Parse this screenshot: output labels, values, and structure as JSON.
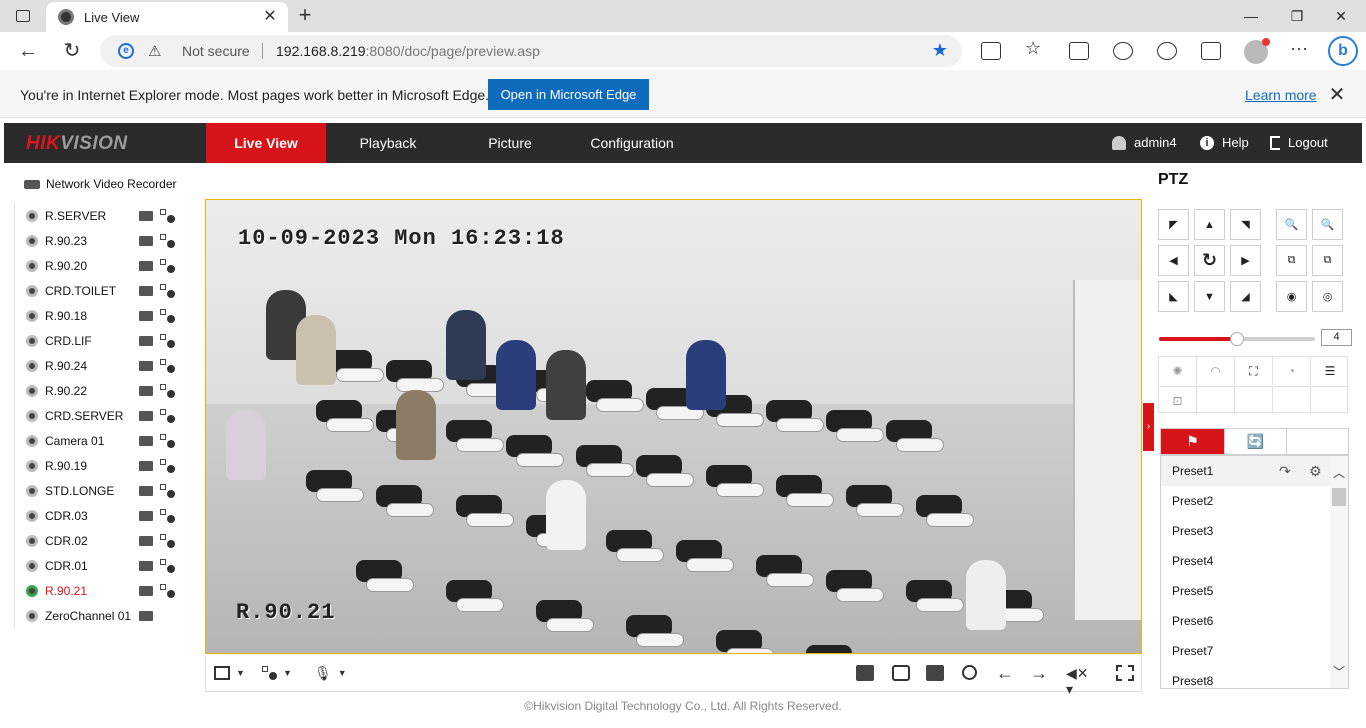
{
  "browser": {
    "tab_title": "Live View",
    "security_label": "Not secure",
    "url_host": "192.168.8.219",
    "url_rest": ":8080/doc/page/preview.asp",
    "ie_message": "You're in Internet Explorer mode. Most pages work better in Microsoft Edge.",
    "open_edge_label": "Open in Microsoft Edge",
    "learn_more_label": "Learn more"
  },
  "app": {
    "logo_hik": "HIK",
    "logo_vision": "VISION",
    "nav": [
      "Live View",
      "Playback",
      "Picture",
      "Configuration"
    ],
    "active_nav": "Live View",
    "user": "admin4",
    "help": "Help",
    "logout": "Logout",
    "accent_color": "#d7141a"
  },
  "device_tree": {
    "root": "Network Video Recorder",
    "cameras": [
      "R.SERVER",
      "R.90.23",
      "R.90.20",
      "CRD.TOILET",
      "R.90.18",
      "CRD.LIF",
      "R.90.24",
      "R.90.22",
      "CRD.SERVER",
      "Camera 01",
      "R.90.19",
      "STD.LONGE",
      "CDR.03",
      "CDR.02",
      "CDR.01",
      "R.90.21",
      "ZeroChannel 01"
    ],
    "selected": "R.90.21"
  },
  "video": {
    "osd_datetime": "10-09-2023 Mon 16:23:18",
    "osd_camera": "R.90.21"
  },
  "ptz": {
    "title": "PTZ",
    "speed": "4",
    "speed_fraction": 0.5,
    "presets": [
      "Preset1",
      "Preset2",
      "Preset3",
      "Preset4",
      "Preset5",
      "Preset6",
      "Preset7",
      "Preset8"
    ]
  },
  "footer": {
    "copyright": "©Hikvision Digital Technology Co., Ltd. All Rights Reserved."
  }
}
